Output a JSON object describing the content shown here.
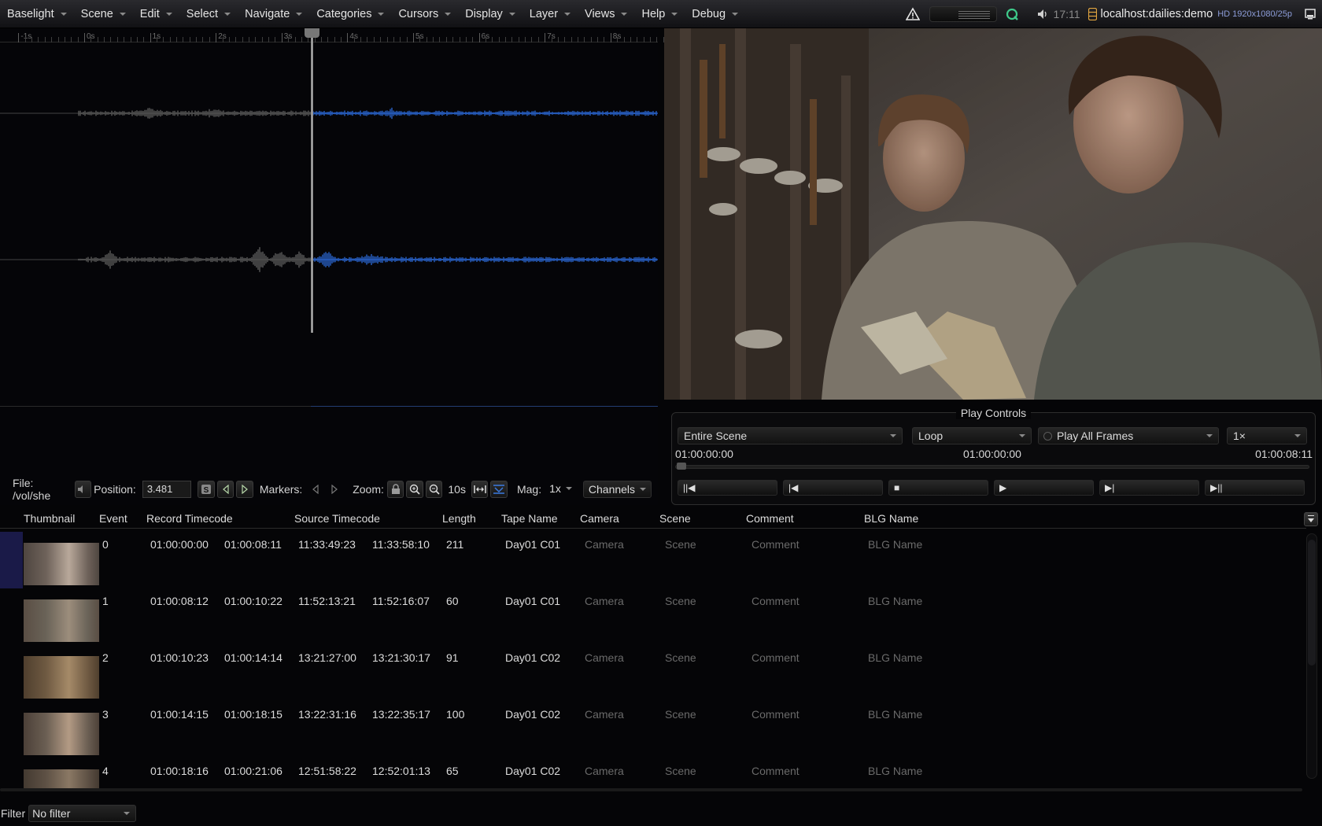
{
  "menubar": {
    "items": [
      "Baselight",
      "Scene",
      "Edit",
      "Select",
      "Navigate",
      "Categories",
      "Cursors",
      "Display",
      "Layer",
      "Views",
      "Help",
      "Debug"
    ],
    "clock": "17:11",
    "host": "localhost:dailies:demo",
    "format": "HD 1920x1080/25p",
    "icons": [
      "warning-icon",
      "activity-meter",
      "q-icon",
      "speaker-icon",
      "database-icon",
      "monitor-icon"
    ]
  },
  "ruler": {
    "labels": [
      "-1s",
      "0s",
      "1s",
      "2s",
      "3s",
      "4s",
      "5s",
      "6s",
      "7s",
      "8s"
    ]
  },
  "audio_toolbar": {
    "file_label": "File: /vol/she",
    "position_label": "Position:",
    "position_value": "3.481",
    "markers_label": "Markers:",
    "zoom_label": "Zoom:",
    "zoom_value": "10s",
    "mag_label": "Mag:",
    "mag_value": "1x",
    "channels_label": "Channels"
  },
  "play_controls": {
    "title": "Play Controls",
    "range": "Entire Scene",
    "mode": "Loop",
    "frames": "Play All Frames",
    "speed": "1×",
    "tc_start": "01:00:00:00",
    "tc_current": "01:00:00:00",
    "tc_end": "01:00:08:11",
    "transport": [
      "||◀",
      "|◀",
      "■",
      "▶",
      "▶|",
      "▶||"
    ]
  },
  "table": {
    "headers": {
      "thumbnail": "Thumbnail",
      "event": "Event",
      "record_tc": "Record Timecode",
      "source_tc": "Source Timecode",
      "length": "Length",
      "tape": "Tape Name",
      "camera": "Camera",
      "scene": "Scene",
      "comment": "Comment",
      "blg": "BLG Name"
    },
    "rows": [
      {
        "event": "0",
        "rec_in": "01:00:00:00",
        "rec_out": "01:00:08:11",
        "src_in": "11:33:49:23",
        "src_out": "11:33:58:10",
        "length": "211",
        "tape": "Day01 C01",
        "camera": "Camera",
        "scene": "Scene",
        "comment": "Comment",
        "blg": "BLG Name"
      },
      {
        "event": "1",
        "rec_in": "01:00:08:12",
        "rec_out": "01:00:10:22",
        "src_in": "11:52:13:21",
        "src_out": "11:52:16:07",
        "length": "60",
        "tape": "Day01 C01",
        "camera": "Camera",
        "scene": "Scene",
        "comment": "Comment",
        "blg": "BLG Name"
      },
      {
        "event": "2",
        "rec_in": "01:00:10:23",
        "rec_out": "01:00:14:14",
        "src_in": "13:21:27:00",
        "src_out": "13:21:30:17",
        "length": "91",
        "tape": "Day01 C02",
        "camera": "Camera",
        "scene": "Scene",
        "comment": "Comment",
        "blg": "BLG Name"
      },
      {
        "event": "3",
        "rec_in": "01:00:14:15",
        "rec_out": "01:00:18:15",
        "src_in": "13:22:31:16",
        "src_out": "13:22:35:17",
        "length": "100",
        "tape": "Day01 C02",
        "camera": "Camera",
        "scene": "Scene",
        "comment": "Comment",
        "blg": "BLG Name"
      },
      {
        "event": "4",
        "rec_in": "01:00:18:16",
        "rec_out": "01:00:21:06",
        "src_in": "12:51:58:22",
        "src_out": "12:52:01:13",
        "length": "65",
        "tape": "Day01 C02",
        "camera": "Camera",
        "scene": "Scene",
        "comment": "Comment",
        "blg": "BLG Name"
      }
    ]
  },
  "filter": {
    "label": "Filter",
    "value": "No filter"
  },
  "colors": {
    "accent_blue": "#2a63c8",
    "selection": "#1a1a48",
    "waveform_grey": "#5a5a5a"
  }
}
